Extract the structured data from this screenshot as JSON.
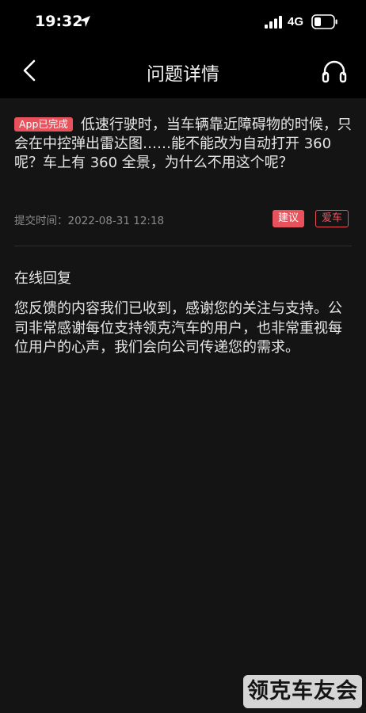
{
  "status_bar": {
    "time": "19:32",
    "network": "4G",
    "location_icon": "location-arrow-icon",
    "signal_icon": "cellular-signal-icon",
    "battery_icon": "battery-low-icon"
  },
  "nav": {
    "title": "问题详情",
    "back_icon": "chevron-left-icon",
    "service_icon": "headset-icon"
  },
  "question": {
    "status_badge": "App已完成",
    "text": "低速行驶时，当车辆靠近障碍物的时候，只会在中控弹出雷达图……能不能改为自动打开 360 呢？车上有 360 全景，为什么不用这个呢？",
    "submit_time_label": "提交时间：2022-08-31 12:18",
    "tags": [
      "建议",
      "爱车"
    ]
  },
  "reply": {
    "heading": "在线回复",
    "text": "您反馈的内容我们已收到，感谢您的关注与支持。公司非常感谢每位支持领克汽车的用户，也非常重视每位用户的心声，我们会向公司传递您的需求。"
  },
  "watermark": "领克车友会",
  "colors": {
    "background": "#141414",
    "header": "#000000",
    "accent": "#e8525c",
    "secondary_text": "#8a8a8a"
  }
}
